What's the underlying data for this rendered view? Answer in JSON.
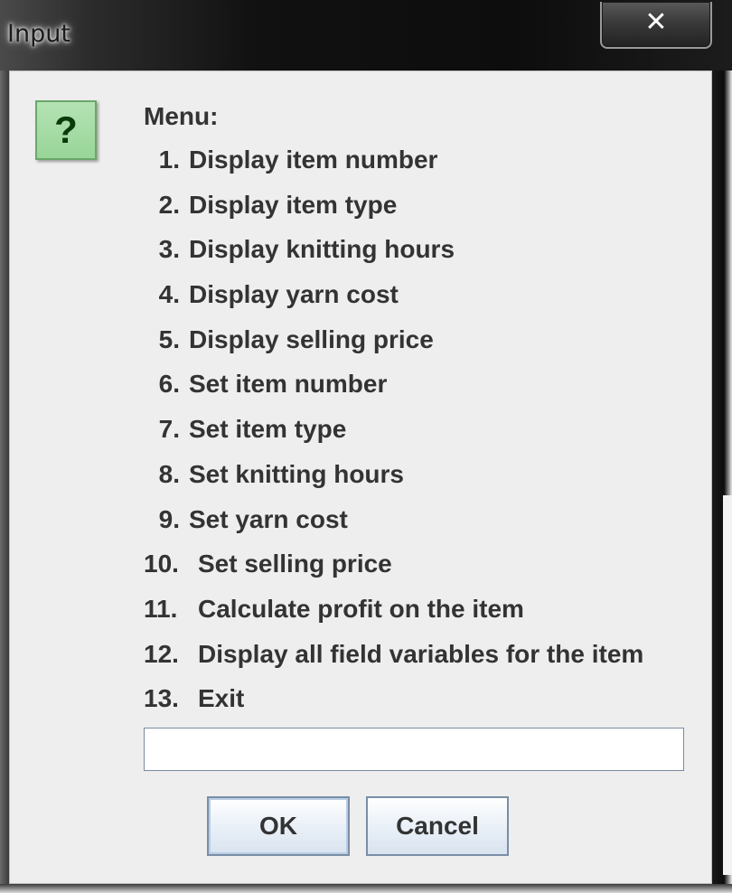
{
  "window": {
    "title": "Input",
    "close_glyph": "✕"
  },
  "dialog": {
    "icon": "question-icon",
    "icon_glyph": "?",
    "icon_color": "#a6dca6",
    "menu_title": "Menu:",
    "items": [
      {
        "num": "1.",
        "label": "Display item number"
      },
      {
        "num": "2.",
        "label": "Display item type"
      },
      {
        "num": "3.",
        "label": "Display knitting hours"
      },
      {
        "num": "4.",
        "label": "Display yarn cost"
      },
      {
        "num": "5.",
        "label": "Display selling price"
      },
      {
        "num": "6.",
        "label": "Set item number"
      },
      {
        "num": "7.",
        "label": "Set item type"
      },
      {
        "num": "8.",
        "label": "Set knitting hours"
      },
      {
        "num": "9.",
        "label": "Set yarn cost"
      },
      {
        "num": "10.",
        "label": "Set selling price"
      },
      {
        "num": "11.",
        "label": "Calculate profit on the item"
      },
      {
        "num": "12.",
        "label": "Display all field variables for the item"
      },
      {
        "num": "13.",
        "label": "Exit"
      }
    ],
    "input": {
      "value": "",
      "placeholder": ""
    },
    "ok_label": "OK",
    "cancel_label": "Cancel"
  }
}
